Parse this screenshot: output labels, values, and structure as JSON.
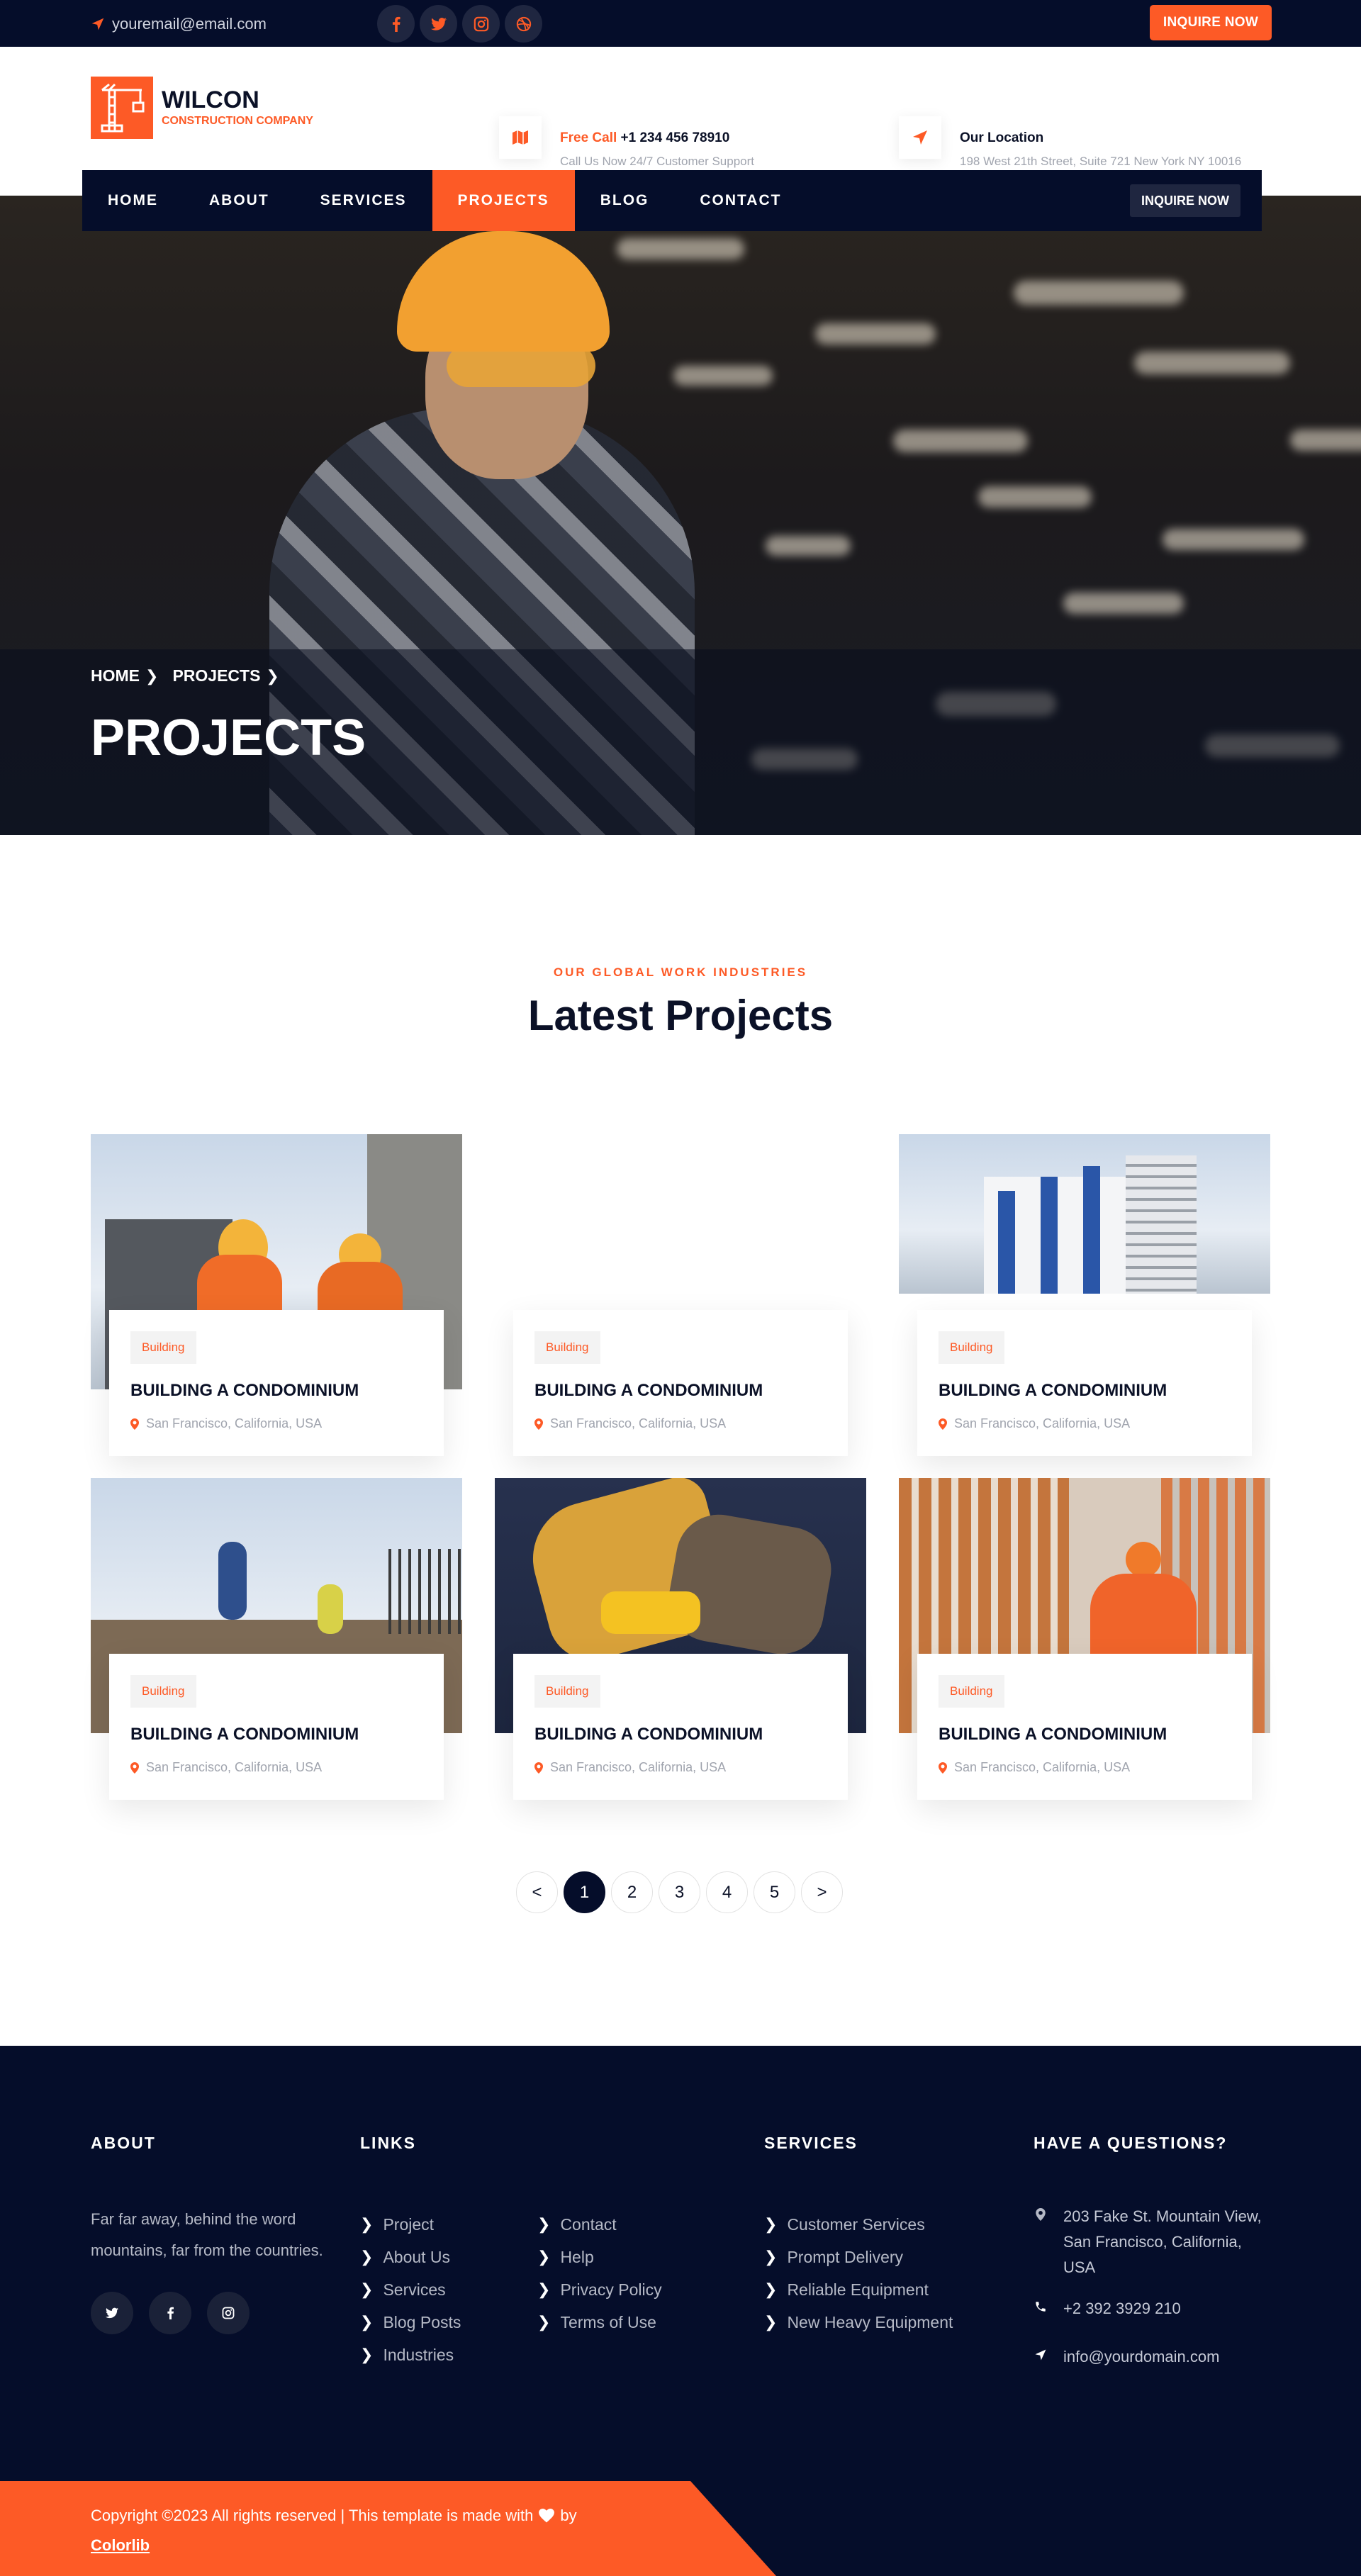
{
  "colors": {
    "accent": "#fd5a26",
    "navy": "#050d2a"
  },
  "topbar": {
    "email": "youremail@email.com",
    "social_icons": [
      "facebook-icon",
      "twitter-icon",
      "instagram-icon",
      "dribbble-icon"
    ],
    "inquire_label": "INQUIRE NOW"
  },
  "header": {
    "logo_name": "WILCON",
    "logo_sub": "CONSTRUCTION COMPANY",
    "call": {
      "label_accent": "Free Call",
      "phone": "+1 234 456 78910",
      "sub": "Call Us Now 24/7 Customer Support"
    },
    "location": {
      "title": "Our Location",
      "sub": "198 West 21th Street, Suite 721 New York NY 10016"
    }
  },
  "nav": {
    "items": [
      "HOME",
      "ABOUT",
      "SERVICES",
      "PROJECTS",
      "BLOG",
      "CONTACT"
    ],
    "active": "PROJECTS",
    "inquire_label": "INQUIRE NOW"
  },
  "hero": {
    "breadcrumb": [
      "HOME",
      "PROJECTS"
    ],
    "title": "PROJECTS"
  },
  "section": {
    "subtitle": "OUR GLOBAL WORK INDUSTRIES",
    "title": "Latest Projects"
  },
  "projects": [
    {
      "tag": "Building",
      "title": "BUILDING A CONDOMINIUM",
      "location": "San Francisco, California, USA"
    },
    {
      "tag": "Building",
      "title": "BUILDING A CONDOMINIUM",
      "location": "San Francisco, California, USA"
    },
    {
      "tag": "Building",
      "title": "BUILDING A CONDOMINIUM",
      "location": "San Francisco, California, USA"
    },
    {
      "tag": "Building",
      "title": "BUILDING A CONDOMINIUM",
      "location": "San Francisco, California, USA"
    },
    {
      "tag": "Building",
      "title": "BUILDING A CONDOMINIUM",
      "location": "San Francisco, California, USA"
    },
    {
      "tag": "Building",
      "title": "BUILDING A CONDOMINIUM",
      "location": "San Francisco, California, USA"
    }
  ],
  "pagination": {
    "prev": "<",
    "pages": [
      "1",
      "2",
      "3",
      "4",
      "5"
    ],
    "active": "1",
    "next": ">"
  },
  "footer": {
    "about": {
      "heading": "ABOUT",
      "text": "Far far away, behind the word mountains, far from the countries."
    },
    "links": {
      "heading": "LINKS",
      "col1": [
        "Project",
        "About Us",
        "Services",
        "Blog Posts",
        "Industries"
      ],
      "col2": [
        "Contact",
        "Help",
        "Privacy Policy",
        "Terms of Use"
      ]
    },
    "services": {
      "heading": "SERVICES",
      "items": [
        "Customer Services",
        "Prompt Delivery",
        "Reliable Equipment",
        "New Heavy Equipment"
      ]
    },
    "contact": {
      "heading": "HAVE A QUESTIONS?",
      "address": "203 Fake St. Mountain View, San Francisco, California, USA",
      "phone": "+2 392 3929 210",
      "email": "info@yourdomain.com"
    },
    "copyright": {
      "text": "Copyright ©2023 All rights reserved | This template is made with",
      "by": "by",
      "link": "Colorlib"
    }
  }
}
